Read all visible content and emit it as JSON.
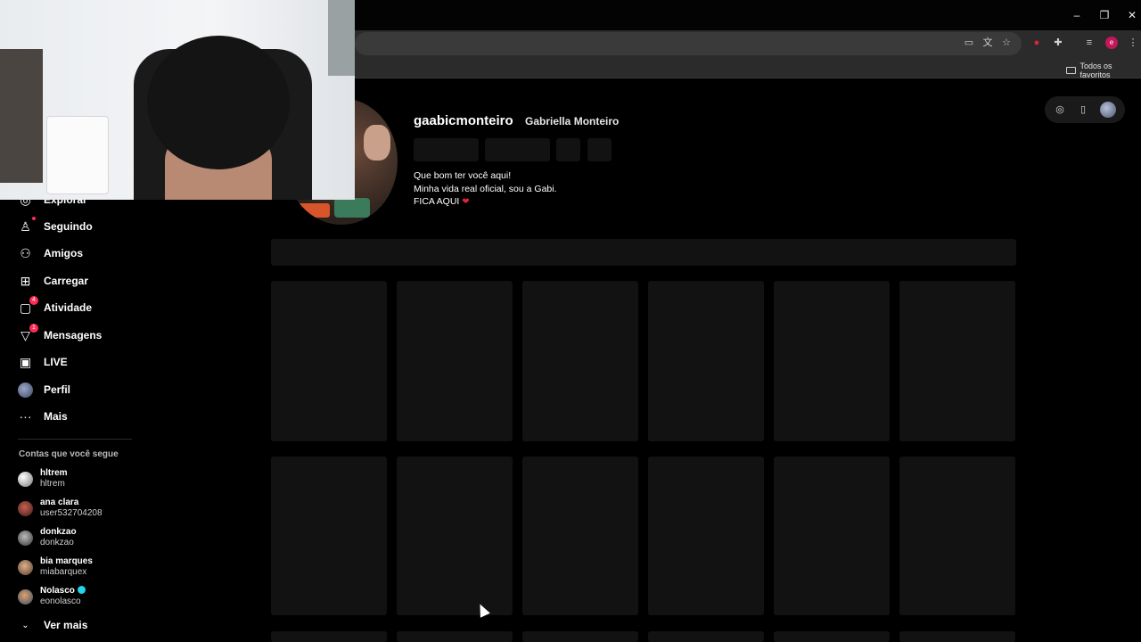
{
  "browser": {
    "bookmark_folder": "Todos os favoritos",
    "controls": {
      "minimize": "–",
      "restore": "❐",
      "close": "✕"
    },
    "toolbar_icons": [
      "install-icon",
      "translate-icon",
      "star-icon",
      "extension-red-icon",
      "extensions-icon",
      "media-icon",
      "profile-icon",
      "menu-icon"
    ]
  },
  "sidebar": {
    "items": [
      {
        "label": "Explorar",
        "icon": "compass-icon"
      },
      {
        "label": "Seguindo",
        "icon": "following-icon",
        "dot": true
      },
      {
        "label": "Amigos",
        "icon": "friends-icon"
      },
      {
        "label": "Carregar",
        "icon": "upload-icon"
      },
      {
        "label": "Atividade",
        "icon": "activity-icon",
        "badge": "4"
      },
      {
        "label": "Mensagens",
        "icon": "messages-icon",
        "badge": "1"
      },
      {
        "label": "LIVE",
        "icon": "live-icon"
      },
      {
        "label": "Perfil",
        "icon": "avatar"
      },
      {
        "label": "Mais",
        "icon": "more-icon"
      }
    ],
    "following_title": "Contas que você segue",
    "following": [
      {
        "name": "hltrem",
        "username": "hltrem"
      },
      {
        "name": "ana clara",
        "username": "user532704208"
      },
      {
        "name": "donkzao",
        "username": "donkzao"
      },
      {
        "name": "bia marques",
        "username": "miabarquex"
      },
      {
        "name": "Nolasco",
        "username": "eonolasco",
        "verified": true
      }
    ],
    "see_more": "Ver mais"
  },
  "profile": {
    "username": "gaabicmonteiro",
    "display_name": "Gabriella Monteiro",
    "bio_lines": [
      "Que bom ter você aqui!",
      "Minha vida real oficial, sou a Gabi.",
      "FICA AQUI"
    ],
    "heart": "❤"
  },
  "colors": {
    "accent": "#fe2c55",
    "background": "#000000",
    "placeholder": "#121212"
  }
}
